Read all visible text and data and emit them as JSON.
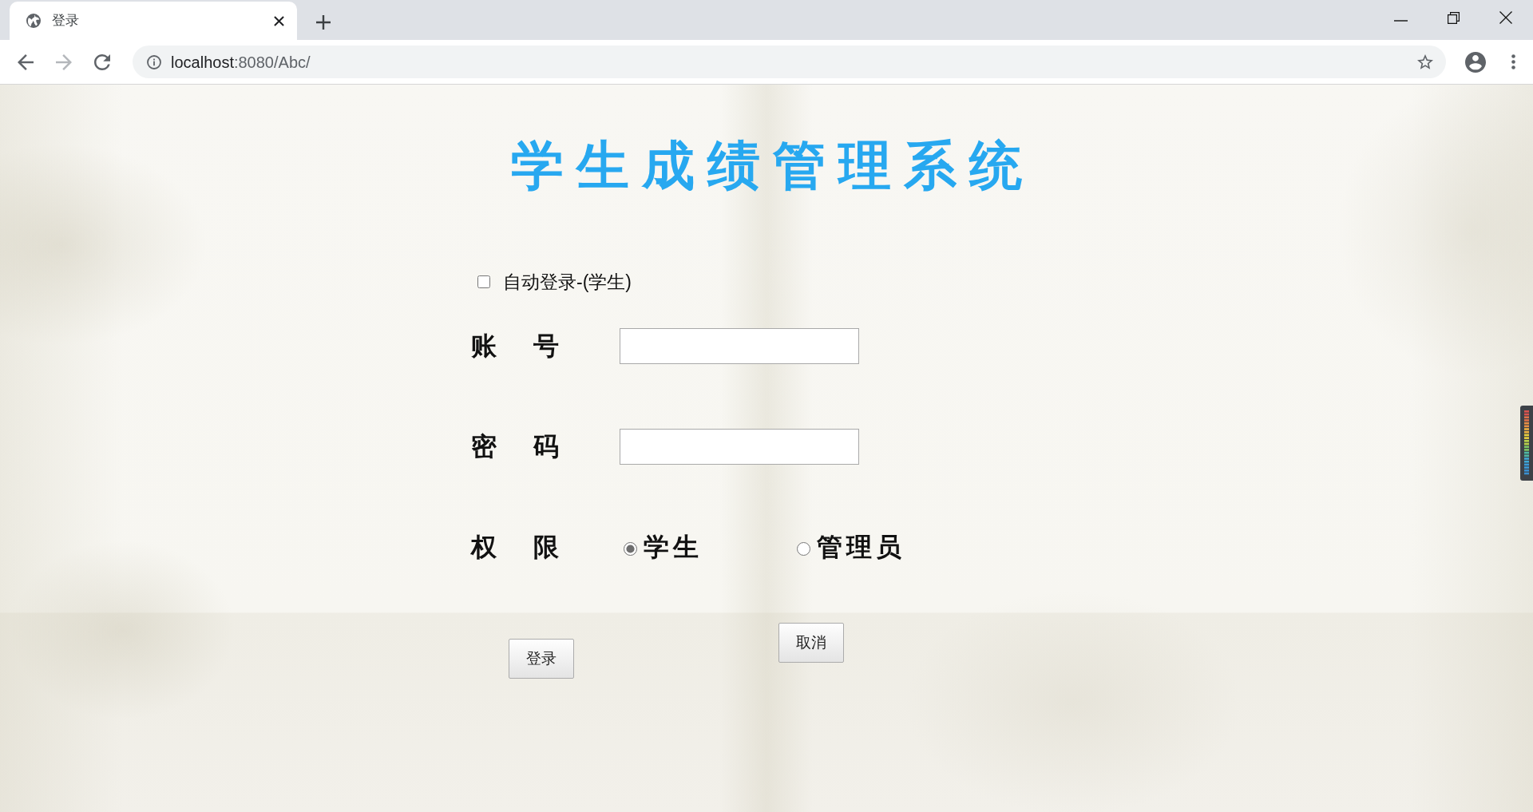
{
  "browser": {
    "tab": {
      "title": "登录"
    },
    "nav_buttons": [
      {
        "kind": "back",
        "disabled": false
      },
      {
        "kind": "forward",
        "disabled": true
      },
      {
        "kind": "reload",
        "disabled": false
      }
    ],
    "address_bar": {
      "host": "localhost",
      "rest": ":8080/Abc/"
    }
  },
  "page": {
    "title": "学生成绩管理系统",
    "auto_login": {
      "label": "自动登录-(学生)",
      "checked": false
    },
    "fields": [
      {
        "label": "账　号"
      },
      {
        "label": "密　码"
      }
    ],
    "role": {
      "label": "权　限",
      "options": [
        {
          "label": "学生",
          "selected": true
        },
        {
          "label": "管理员",
          "selected": false
        }
      ]
    },
    "buttons": [
      {
        "label": "登录"
      },
      {
        "label": "取消"
      }
    ]
  }
}
